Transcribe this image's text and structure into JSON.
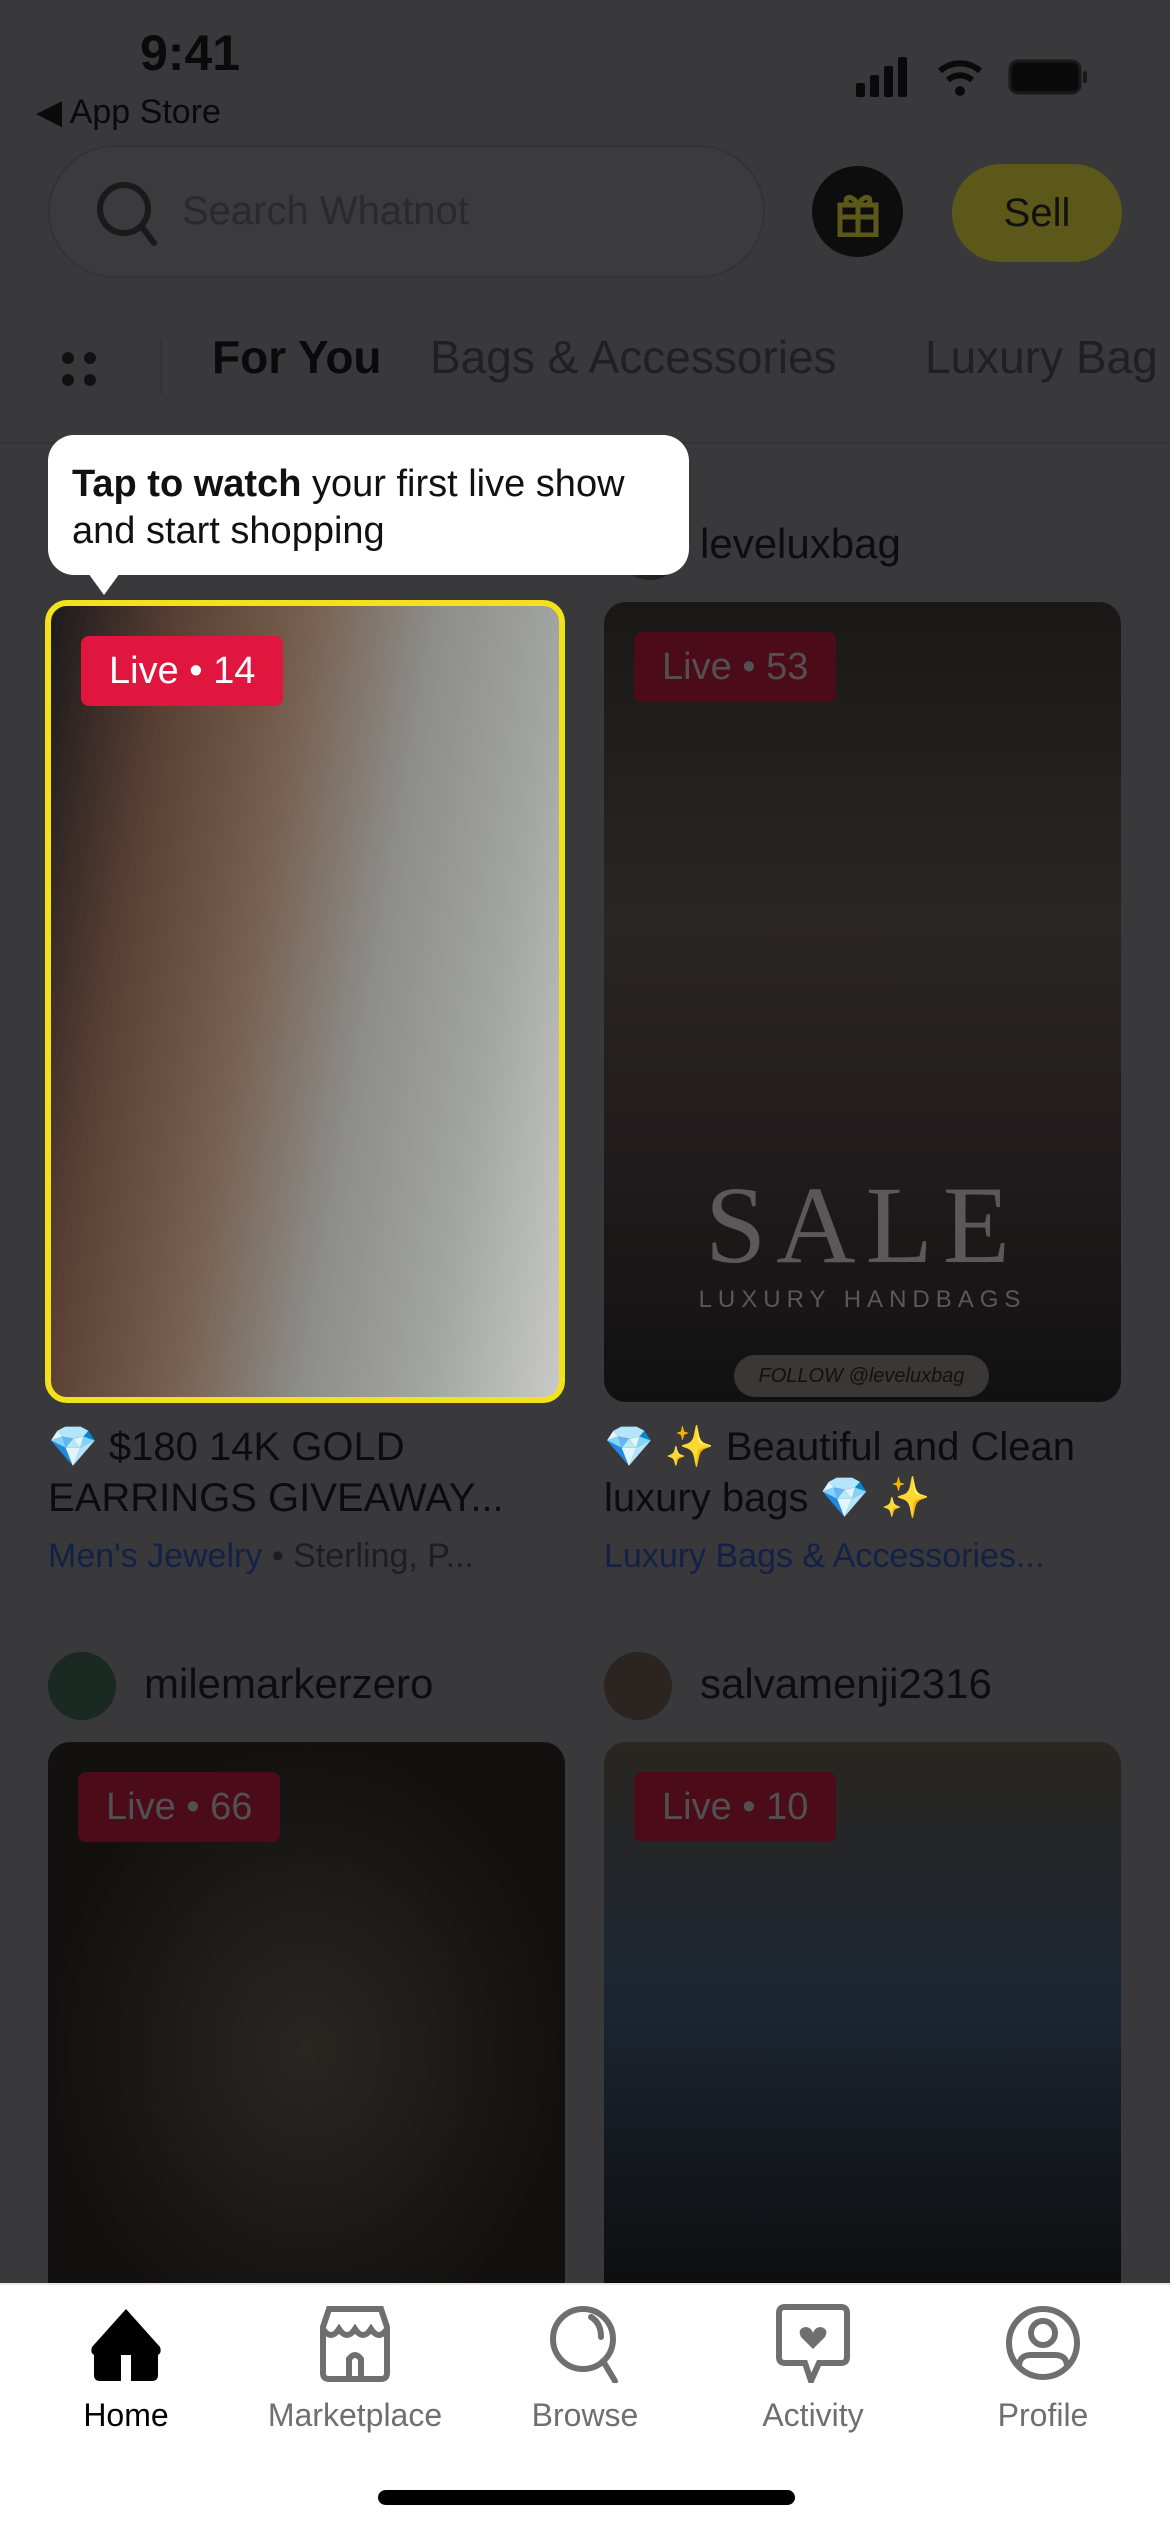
{
  "status_bar": {
    "time": "9:41",
    "back_label": "App Store"
  },
  "header": {
    "search_placeholder": "Search Whatnot",
    "sell_label": "Sell"
  },
  "category_tabs": [
    {
      "label": "For You",
      "active": true
    },
    {
      "label": "Bags & Accessories"
    },
    {
      "label": "Luxury Bag"
    }
  ],
  "tooltip": {
    "bold": "Tap to watch",
    "rest": " your first live show and start shopping"
  },
  "shows": [
    {
      "user": "",
      "live_label": "Live • 14",
      "title": "💎 $180 14K GOLD EARRINGS GIVEAWAY...",
      "category": "Men's Jewelry",
      "subcategory": "Sterling, P..."
    },
    {
      "user": "leveluxbag",
      "live_label": "Live • 53",
      "title": "💎 ✨ Beautiful and Clean luxury bags 💎 ✨",
      "category": "Luxury Bags & Accessories...",
      "subcategory": "",
      "thumb_text": {
        "sale": "SALE",
        "sub": "LUXURY HANDBAGS",
        "follow": "FOLLOW @leveluxbag"
      }
    },
    {
      "user": "milemarkerzero",
      "live_label": "Live • 66"
    },
    {
      "user": "salvamenji2316",
      "live_label": "Live • 10"
    }
  ],
  "tab_bar": [
    {
      "label": "Home",
      "icon": "home-icon",
      "active": true
    },
    {
      "label": "Marketplace",
      "icon": "storefront-icon"
    },
    {
      "label": "Browse",
      "icon": "search-icon"
    },
    {
      "label": "Activity",
      "icon": "heart-message-icon"
    },
    {
      "label": "Profile",
      "icon": "profile-icon"
    }
  ],
  "colors": {
    "accent_yellow": "#f1e21b",
    "live_red": "#e0163f",
    "category_blue": "#2f4fb0"
  }
}
